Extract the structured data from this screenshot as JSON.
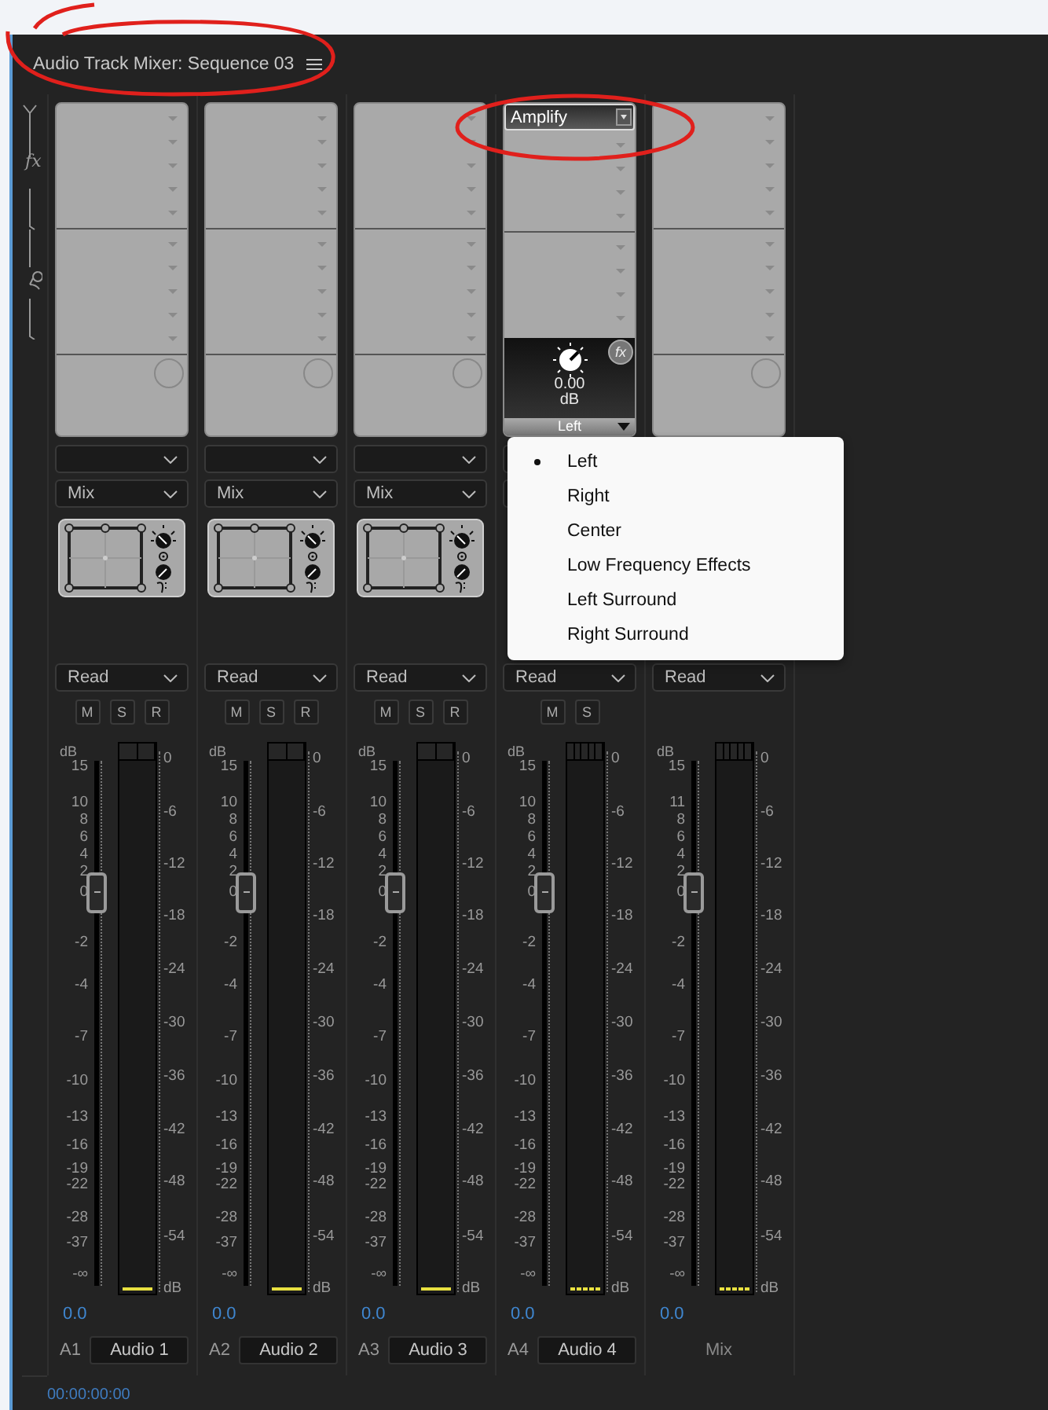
{
  "panel": {
    "title": "Audio Track Mixer: Sequence 03",
    "effects_label": "fx"
  },
  "tracks": [
    {
      "kind": "track",
      "label": "A1",
      "name": "Audio 1",
      "mix": "Mix",
      "automation": "Read",
      "buttons": [
        "M",
        "S",
        "R"
      ],
      "scale": [
        "15",
        "10",
        "8",
        "6",
        "4",
        "2",
        "0",
        "-2",
        "-4",
        "-7",
        "-10",
        "-13",
        "-16",
        "-19",
        "-22",
        "-28",
        "-37",
        "-∞"
      ],
      "scale_unit": "dB",
      "multichannel_meter": false,
      "meter_scale": [
        "0",
        "-6",
        "-12",
        "-18",
        "-24",
        "-30",
        "-36",
        "-42",
        "-48",
        "-54",
        "dB"
      ],
      "value": "0.0"
    },
    {
      "kind": "track",
      "label": "A2",
      "name": "Audio 2",
      "mix": "Mix",
      "automation": "Read",
      "buttons": [
        "M",
        "S",
        "R"
      ],
      "scale": [
        "15",
        "10",
        "8",
        "6",
        "4",
        "2",
        "0",
        "-2",
        "-4",
        "-7",
        "-10",
        "-13",
        "-16",
        "-19",
        "-22",
        "-28",
        "-37",
        "-∞"
      ],
      "scale_unit": "dB",
      "multichannel_meter": false,
      "meter_scale": [
        "0",
        "-6",
        "-12",
        "-18",
        "-24",
        "-30",
        "-36",
        "-42",
        "-48",
        "-54",
        "dB"
      ],
      "value": "0.0"
    },
    {
      "kind": "track",
      "label": "A3",
      "name": "Audio 3",
      "mix": "Mix",
      "automation": "Read",
      "buttons": [
        "M",
        "S",
        "R"
      ],
      "scale": [
        "15",
        "10",
        "8",
        "6",
        "4",
        "2",
        "0",
        "-2",
        "-4",
        "-7",
        "-10",
        "-13",
        "-16",
        "-19",
        "-22",
        "-28",
        "-37",
        "-∞"
      ],
      "scale_unit": "dB",
      "multichannel_meter": false,
      "meter_scale": [
        "0",
        "-6",
        "-12",
        "-18",
        "-24",
        "-30",
        "-36",
        "-42",
        "-48",
        "-54",
        "dB"
      ],
      "value": "0.0"
    },
    {
      "kind": "track",
      "label": "A4",
      "name": "Audio 4",
      "effect_slots": [
        "Amplify"
      ],
      "effect_panel": {
        "value": "0.00",
        "unit": "dB",
        "channel": "Left",
        "badge": "fx"
      },
      "automation": "Read",
      "buttons": [
        "M",
        "S"
      ],
      "scale": [
        "15",
        "10",
        "8",
        "6",
        "4",
        "2",
        "0",
        "-2",
        "-4",
        "-7",
        "-10",
        "-13",
        "-16",
        "-19",
        "-22",
        "-28",
        "-37",
        "-∞"
      ],
      "scale_unit": "dB",
      "multichannel_meter": true,
      "meter_scale": [
        "0",
        "-6",
        "-12",
        "-18",
        "-24",
        "-30",
        "-36",
        "-42",
        "-48",
        "-54",
        "dB"
      ],
      "value": "0.0"
    },
    {
      "kind": "master",
      "name": "Mix",
      "automation": "Read",
      "scale": [
        "15",
        "11",
        "8",
        "6",
        "4",
        "2",
        "0",
        "-2",
        "-4",
        "-7",
        "-10",
        "-13",
        "-16",
        "-19",
        "-22",
        "-28",
        "-37",
        "-∞"
      ],
      "scale_unit": "dB",
      "multichannel_meter": true,
      "meter_scale": [
        "0",
        "-6",
        "-12",
        "-18",
        "-24",
        "-30",
        "-36",
        "-42",
        "-48",
        "-54",
        "dB"
      ],
      "value": "0.0"
    }
  ],
  "channel_menu": {
    "items": [
      {
        "label": "Left",
        "selected": true
      },
      {
        "label": "Right",
        "selected": false
      },
      {
        "label": "Center",
        "selected": false
      },
      {
        "label": "Low Frequency Effects",
        "selected": false
      },
      {
        "label": "Left Surround",
        "selected": false
      },
      {
        "label": "Right Surround",
        "selected": false
      }
    ]
  },
  "timecode": "00:00:00:00"
}
